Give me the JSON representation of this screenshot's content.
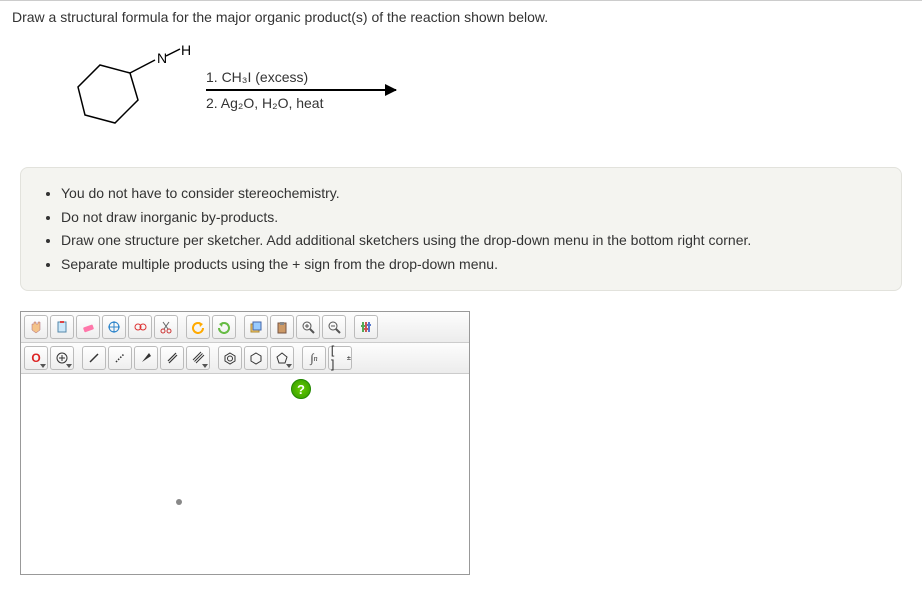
{
  "question": "Draw a structural formula for the major organic product(s) of the reaction shown below.",
  "reaction": {
    "structure_label_N": "N",
    "structure_label_H": "H",
    "reagent1": "1. CH₃I  (excess)",
    "reagent2": "2. Ag₂O, H₂O, heat"
  },
  "instructions": [
    "You do not have to consider stereochemistry.",
    "Do not draw inorganic by-products.",
    "Draw one structure per sketcher. Add additional sketchers using the drop-down menu in the bottom right corner.",
    "Separate multiple products using the + sign from the drop-down menu."
  ],
  "toolbar": {
    "row1": [
      "hand",
      "clear",
      "eraser",
      "move",
      "glasses",
      "scissors",
      "",
      "undo",
      "redo",
      "",
      "paste-special",
      "paste",
      "zoom-in",
      "zoom-out",
      "",
      "settings"
    ],
    "row2": [
      "atom-O",
      "charge-plus",
      "",
      "bond-single",
      "bond-wedge",
      "bond-dash",
      "bond-double",
      "bond-triple",
      "",
      "ring-benzene",
      "ring-cyclohexane",
      "ring-cyclopentane",
      "",
      "curve-n",
      "brackets"
    ]
  },
  "atom_label": "O",
  "help": "?",
  "chart_data": null
}
